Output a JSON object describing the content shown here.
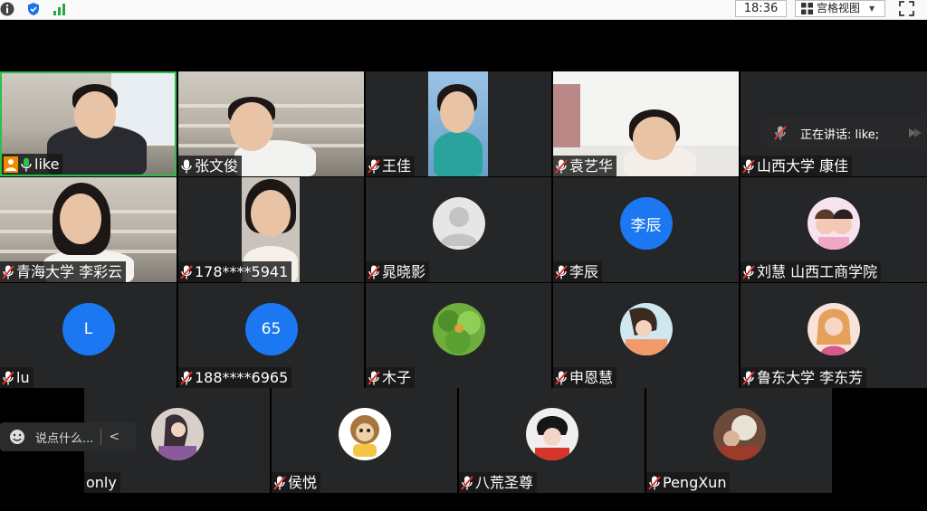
{
  "topbar": {
    "clock": "18:36",
    "view_mode": "宫格视图",
    "icons": [
      "info-icon",
      "shield-icon",
      "signal-icon",
      "grid-icon",
      "fullscreen-icon"
    ]
  },
  "speaking": {
    "label": "正在讲话: like;"
  },
  "chat": {
    "placeholder": "说点什么..."
  },
  "participants": [
    {
      "id": "like",
      "name": "like",
      "mic": "on",
      "video": true,
      "active": true
    },
    {
      "id": "zhangwenjun",
      "name": "张文俊",
      "mic": "on",
      "video": true
    },
    {
      "id": "wangjia",
      "name": "王佳",
      "mic": "muted",
      "video": true
    },
    {
      "id": "yuanyihua",
      "name": "袁艺华",
      "mic": "muted",
      "video": true
    },
    {
      "id": "kangjia",
      "name": "山西大学 康佳",
      "mic": "muted",
      "video": false
    },
    {
      "id": "licaiyun",
      "name": "青海大学 李彩云",
      "mic": "muted",
      "video": true
    },
    {
      "id": "p178",
      "name": "178****5941",
      "mic": "muted",
      "video": true
    },
    {
      "id": "huangxiaoying",
      "name": "晁晓影",
      "mic": "muted",
      "avatar": "default"
    },
    {
      "id": "lichen",
      "name": "李辰",
      "mic": "muted",
      "avatar_text": "李辰"
    },
    {
      "id": "liuhui",
      "name": "刘慧 山西工商学院",
      "mic": "muted",
      "avatar": "picture"
    },
    {
      "id": "lu",
      "name": "lu",
      "mic": "muted",
      "avatar_text": "L"
    },
    {
      "id": "p188",
      "name": "188****6965",
      "mic": "muted",
      "avatar_text": "65"
    },
    {
      "id": "muzi",
      "name": "木子",
      "mic": "muted",
      "avatar": "picture"
    },
    {
      "id": "shenenhui",
      "name": "申恩慧",
      "mic": "muted",
      "avatar": "picture"
    },
    {
      "id": "lidongfang",
      "name": "鲁东大学 李东芳",
      "mic": "muted",
      "avatar": "picture"
    },
    {
      "id": "only",
      "name": "only",
      "mic": "none",
      "avatar": "picture"
    },
    {
      "id": "houyue",
      "name": "侯悦",
      "mic": "muted",
      "avatar": "picture"
    },
    {
      "id": "bahuang",
      "name": "八荒圣尊",
      "mic": "muted",
      "avatar": "picture"
    },
    {
      "id": "pengxun",
      "name": "PengXun",
      "mic": "muted",
      "avatar": "picture"
    }
  ],
  "colors": {
    "active_border": "#2dbf4b",
    "avatar_blue": "#1b78f2",
    "tile_bg": "#252628"
  }
}
